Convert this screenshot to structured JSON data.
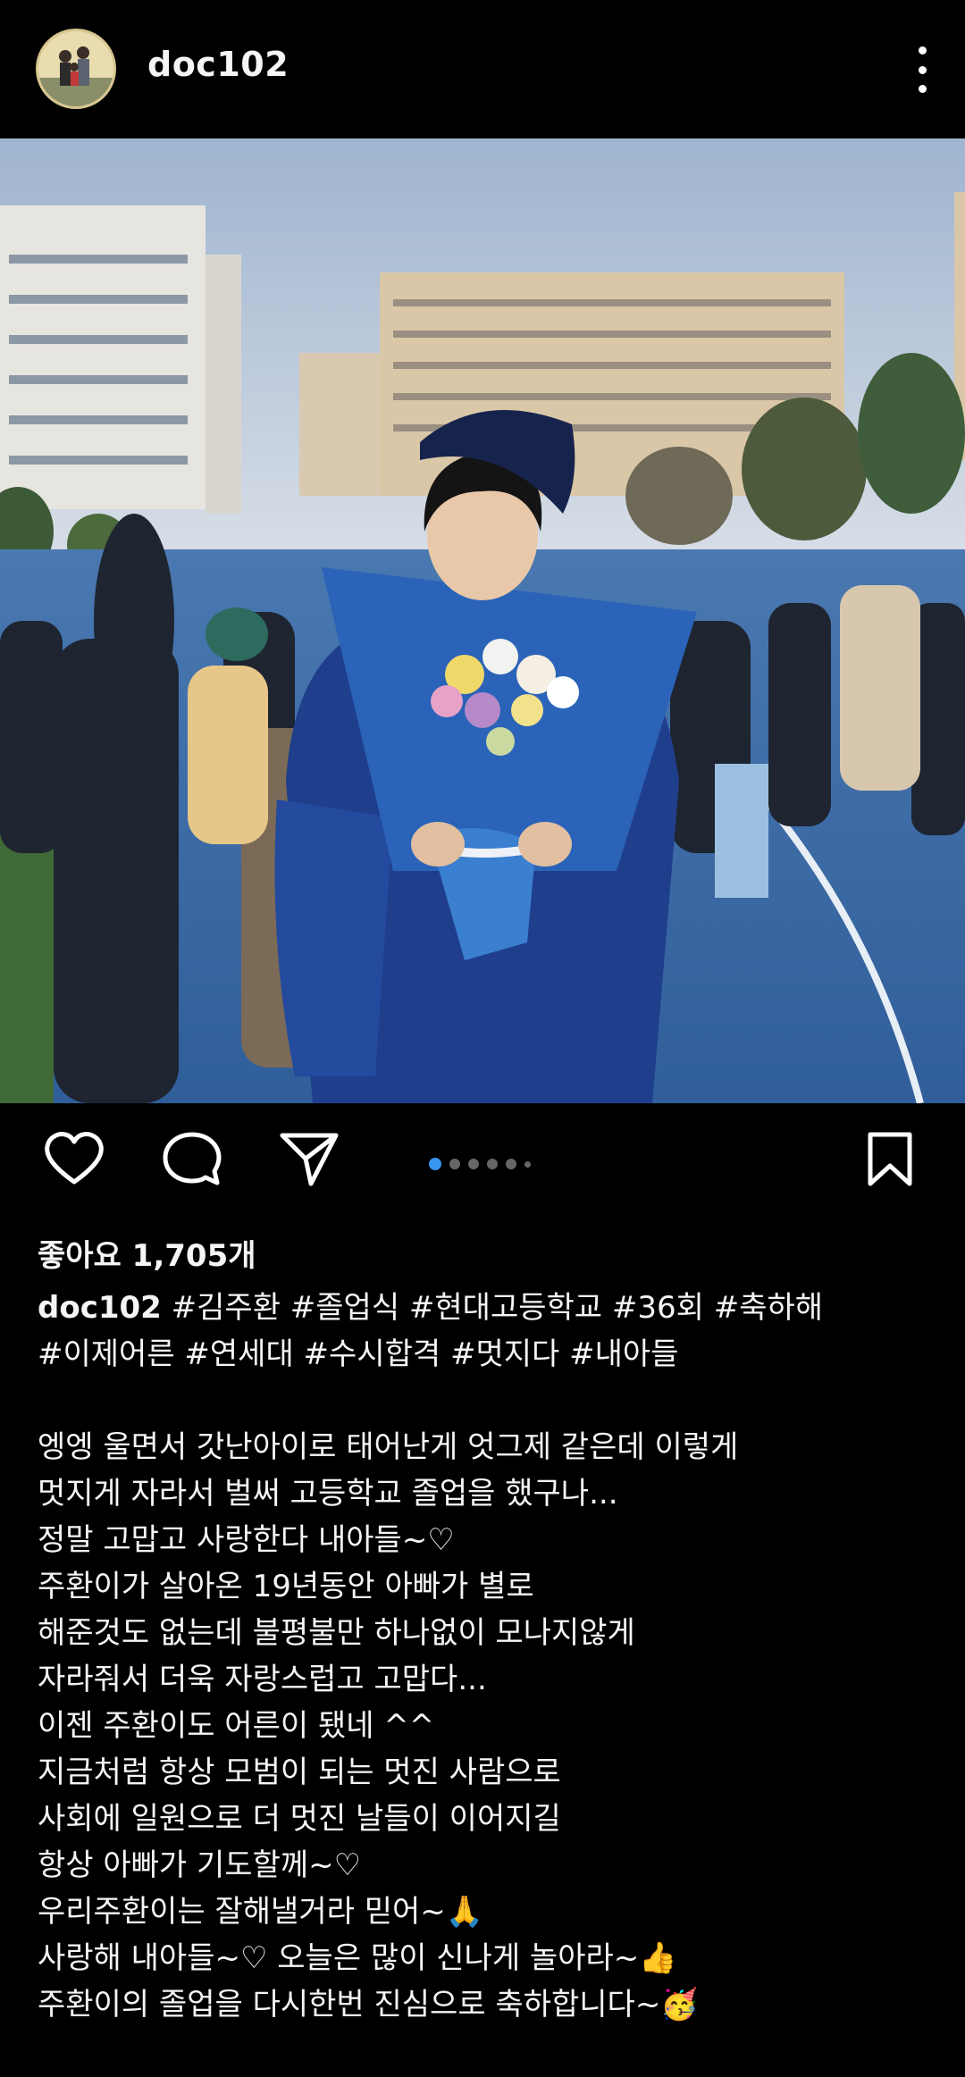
{
  "header": {
    "username": "doc102"
  },
  "post": {
    "likes": "좋아요 1,705개",
    "caption_user": "doc102",
    "hashtags_line1": "#김주환 #졸업식 #현대고등학교 #36회 #축하해",
    "hashtags_line2": "#이제어른 #연세대 #수시합격 #멋지다 #내아들",
    "body": [
      "엥엥 울면서 갓난아이로 태어난게 엇그제 같은데 이렇게",
      "멋지게 자라서 벌써 고등학교 졸업을 했구나...",
      "정말 고맙고 사랑한다 내아들~♡",
      "주환이가 살아온 19년동안 아빠가 별로",
      "해준것도 없는데 불평불만 하나없이 모나지않게",
      "자라줘서 더욱 자랑스럽고 고맙다...",
      "이젠 주환이도 어른이 됐네 ^^",
      "지금처럼 항상 모범이 되는 멋진 사람으로",
      "사회에 일원으로 더 멋진 날들이 이어지길",
      "항상 아빠가 기도할께~♡",
      "우리주환이는 잘해낼거라 믿어~🙏",
      "사랑해 내아들~♡ 오늘은 많이 신나게 놀아라~👍",
      "주환이의 졸업을 다시한번 진심으로 축하합니다~🥳"
    ]
  },
  "carousel": {
    "total": 6,
    "active_index": 0
  },
  "icons": [
    "heart-icon",
    "comment-icon",
    "share-icon",
    "bookmark-icon",
    "more-icon"
  ],
  "colors": {
    "background": "#000000",
    "text": "#f5f5f5",
    "carousel_active": "#3897f0"
  }
}
